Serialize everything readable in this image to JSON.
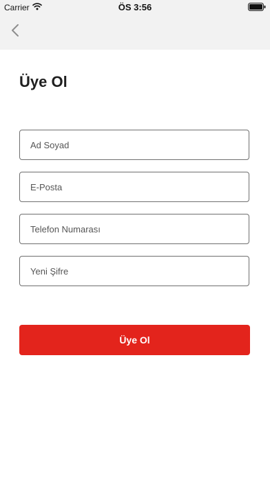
{
  "status_bar": {
    "carrier": "Carrier",
    "time": "ÖS 3:56",
    "wifi_icon": "wifi-icon",
    "battery_icon": "battery-icon"
  },
  "nav": {
    "back_icon": "chevron-left-icon"
  },
  "page": {
    "title": "Üye Ol"
  },
  "form": {
    "name_placeholder": "Ad Soyad",
    "email_placeholder": "E-Posta",
    "phone_placeholder": "Telefon Numarası",
    "password_placeholder": "Yeni Şifre",
    "submit_label": "Üye Ol"
  },
  "colors": {
    "accent": "#e3241c",
    "nav_background": "#f2f2f2",
    "field_border": "#6e6e6e"
  }
}
